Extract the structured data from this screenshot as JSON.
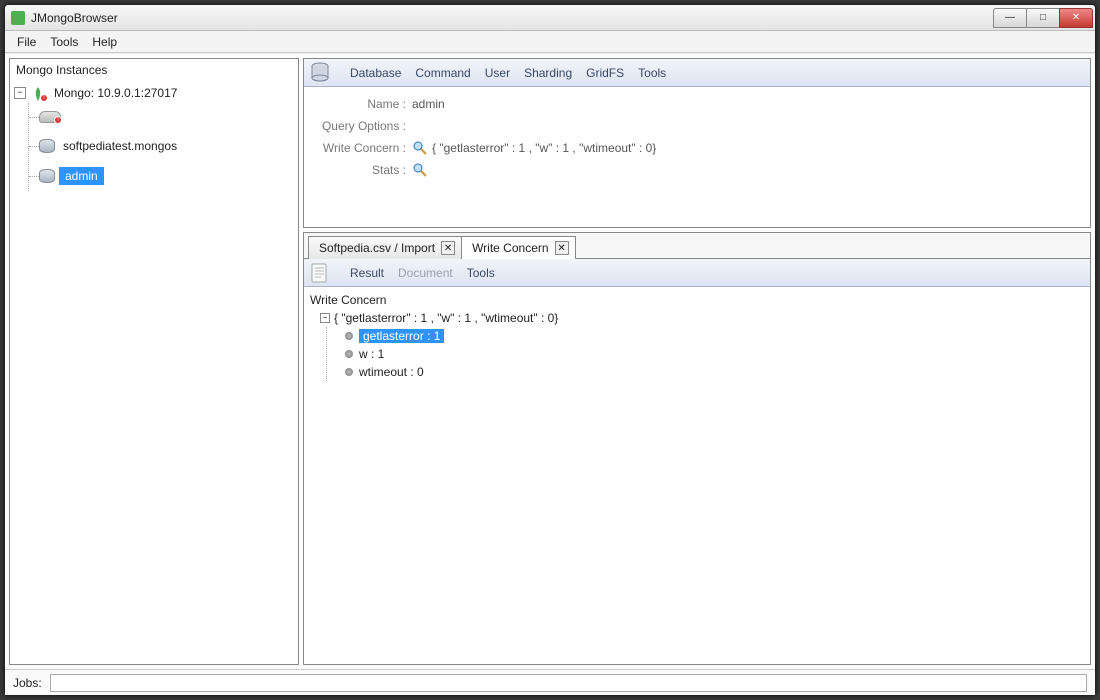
{
  "window": {
    "title": "JMongoBrowser"
  },
  "menubar": {
    "items": [
      "File",
      "Tools",
      "Help"
    ]
  },
  "left": {
    "title": "Mongo Instances",
    "root": "Mongo: 10.9.0.1:27017",
    "server_node": "",
    "children": [
      "softpediatest.mongos",
      "admin"
    ],
    "selected": "admin"
  },
  "dbpanel": {
    "menu": [
      "Database",
      "Command",
      "User",
      "Sharding",
      "GridFS",
      "Tools"
    ],
    "rows": {
      "name_label": "Name :",
      "name_value": "admin",
      "query_label": "Query Options :",
      "wc_label": "Write Concern :",
      "wc_value": "{ \"getlasterror\" : 1 , \"w\" : 1 , \"wtimeout\" : 0}",
      "stats_label": "Stats :"
    }
  },
  "tabs": [
    {
      "label": "Softpedia.csv / Import",
      "active": false
    },
    {
      "label": "Write Concern",
      "active": true
    }
  ],
  "result": {
    "menu": [
      "Result",
      "Document",
      "Tools"
    ],
    "menu_disabled_index": 1,
    "root": "Write Concern",
    "summary": "{ \"getlasterror\" : 1 , \"w\" : 1 , \"wtimeout\" : 0}",
    "fields": [
      {
        "label": "getlasterror : 1",
        "selected": true
      },
      {
        "label": "w : 1",
        "selected": false
      },
      {
        "label": "wtimeout : 0",
        "selected": false
      }
    ]
  },
  "status": {
    "label": "Jobs:"
  },
  "winbuttons": {
    "min": "—",
    "max": "□",
    "close": "✕"
  }
}
